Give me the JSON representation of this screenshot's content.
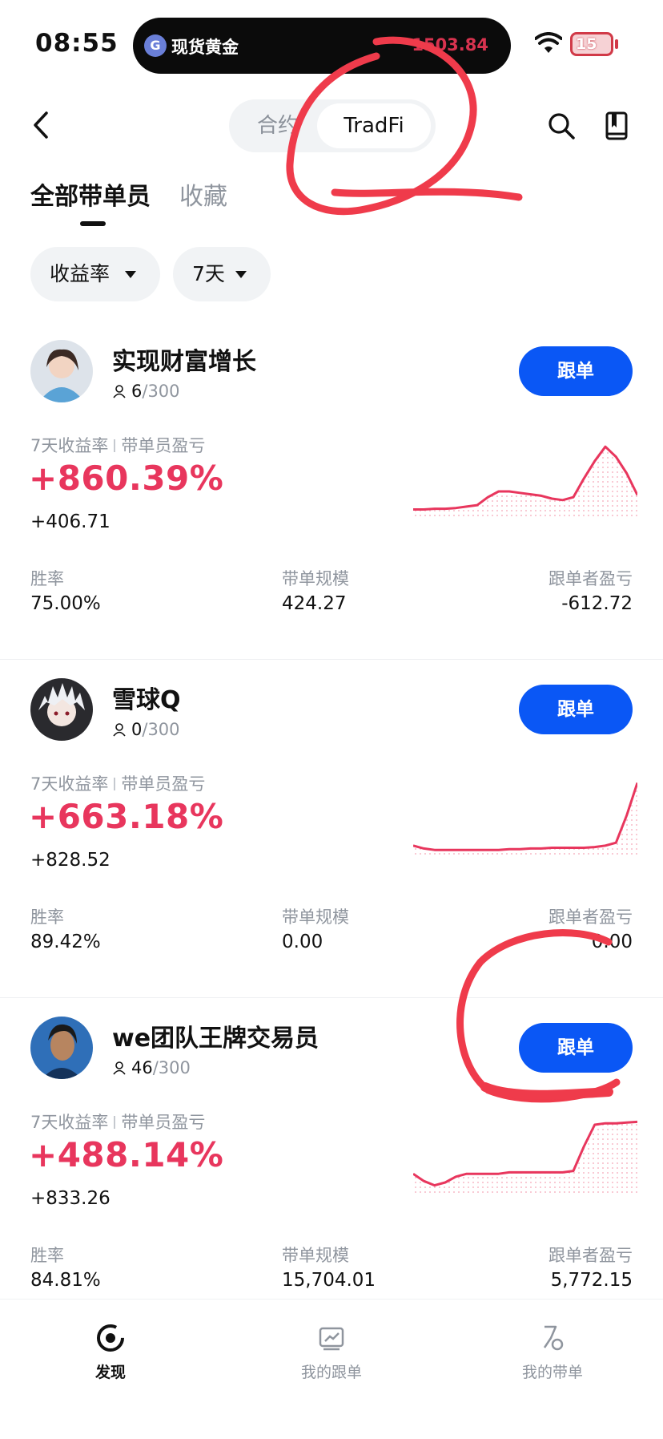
{
  "status_bar": {
    "time": "08:55",
    "live_activity": {
      "icon": "gold-spot-icon",
      "title": "现货黄金",
      "price": "1503.84"
    },
    "battery": "15"
  },
  "nav": {
    "segments": [
      {
        "label": "合约",
        "active": false
      },
      {
        "label": "TradFi",
        "active": true
      }
    ]
  },
  "tabs": [
    {
      "label": "全部带单员",
      "active": true
    },
    {
      "label": "收藏",
      "active": false
    }
  ],
  "filters": [
    {
      "label": "收益率"
    },
    {
      "label": "7天"
    }
  ],
  "traders": [
    {
      "name": "实现财富增长",
      "followers": "6",
      "followers_max": "/300",
      "button": "跟单",
      "metric_label_a": "7天收益率",
      "metric_label_b": "带单员盈亏",
      "roi": "+860.39%",
      "pnl": "+406.71",
      "stats": [
        {
          "label": "胜率",
          "value": "75.00%"
        },
        {
          "label": "带单规模",
          "value": "424.27"
        },
        {
          "label": "跟单者盈亏",
          "value": "-612.72"
        }
      ],
      "sparkline": [
        0.05,
        0.05,
        0.06,
        0.06,
        0.07,
        0.09,
        0.11,
        0.22,
        0.3,
        0.3,
        0.28,
        0.26,
        0.24,
        0.2,
        0.18,
        0.22,
        0.48,
        0.72,
        0.92,
        0.78,
        0.55,
        0.25
      ]
    },
    {
      "name": "雪球Q",
      "followers": "0",
      "followers_max": "/300",
      "button": "跟单",
      "metric_label_a": "7天收益率",
      "metric_label_b": "带单员盈亏",
      "roi": "+663.18%",
      "pnl": "+828.52",
      "stats": [
        {
          "label": "胜率",
          "value": "89.42%"
        },
        {
          "label": "带单规模",
          "value": "0.00"
        },
        {
          "label": "跟单者盈亏",
          "value": "0.00"
        }
      ],
      "sparkline": [
        0.08,
        0.04,
        0.02,
        0.02,
        0.02,
        0.02,
        0.02,
        0.02,
        0.02,
        0.03,
        0.03,
        0.04,
        0.04,
        0.05,
        0.05,
        0.05,
        0.05,
        0.06,
        0.08,
        0.12,
        0.5,
        0.95
      ]
    },
    {
      "name": "we团队王牌交易员",
      "followers": "46",
      "followers_max": "/300",
      "button": "跟单",
      "metric_label_a": "7天收益率",
      "metric_label_b": "带单员盈亏",
      "roi": "+488.14%",
      "pnl": "+833.26",
      "stats": [
        {
          "label": "胜率",
          "value": "84.81%"
        },
        {
          "label": "带单规模",
          "value": "15,704.01"
        },
        {
          "label": "跟单者盈亏",
          "value": "5,772.15"
        }
      ],
      "sparkline": [
        0.22,
        0.12,
        0.06,
        0.1,
        0.18,
        0.22,
        0.22,
        0.22,
        0.22,
        0.24,
        0.24,
        0.24,
        0.24,
        0.24,
        0.24,
        0.26,
        0.6,
        0.9,
        0.92,
        0.92,
        0.93,
        0.94
      ]
    }
  ],
  "bottom_nav": [
    {
      "label": "发现",
      "icon": "discover-icon",
      "active": true
    },
    {
      "label": "我的跟单",
      "icon": "copy-trades-icon",
      "active": false
    },
    {
      "label": "我的带单",
      "icon": "lead-trades-icon",
      "active": false
    }
  ],
  "colors": {
    "accent": "#0a57f5",
    "positive": "#e8365d",
    "annotation": "#ef3b4b"
  }
}
